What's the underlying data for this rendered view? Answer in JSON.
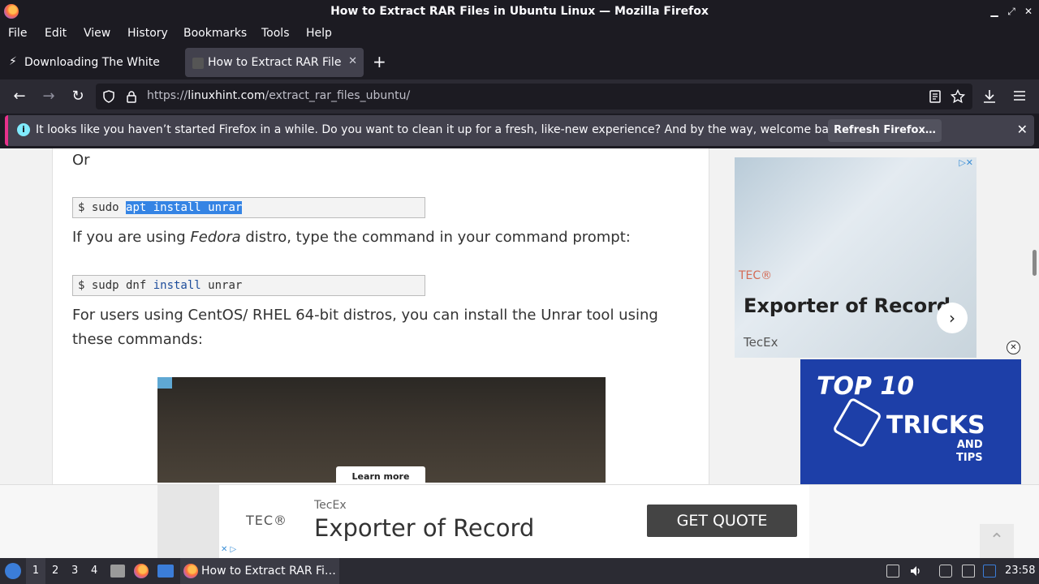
{
  "window": {
    "title": "How to Extract RAR Files in Ubuntu Linux — Mozilla Firefox",
    "minimize": "▁",
    "maximize": "⤢",
    "close": "✕"
  },
  "menu": [
    "File",
    "Edit",
    "View",
    "History",
    "Bookmarks",
    "Tools",
    "Help"
  ],
  "tabs": [
    {
      "label": "Downloading The White H",
      "close": "✕",
      "active": false
    },
    {
      "label": "How to Extract RAR Files",
      "close": "✕",
      "active": true
    }
  ],
  "newtab": "+",
  "nav": {
    "back": "←",
    "forward": "→",
    "reload": "↻",
    "url_prefix": "https://",
    "url_domain": "linuxhint.com",
    "url_path": "/extract_rar_files_ubuntu/"
  },
  "notification": {
    "message": "It looks like you haven’t started Firefox in a while. Do you want to clean it up for a fresh, like-new experience? And by the way, welcome back!",
    "button": "Refresh Firefox…",
    "close": "✕",
    "info": "i"
  },
  "article": {
    "or": "Or",
    "cmd1_prompt": "$ sudo ",
    "cmd1_selected": "apt install unrar",
    "fedora_pre": "If you are using ",
    "fedora_em": "Fedora",
    "fedora_post": " distro, type the command in your command prompt:",
    "cmd2_prompt": "$ sudp dnf ",
    "cmd2_kw": "install",
    "cmd2_rest": " unrar",
    "centos_line1": "For users using CentOS/ RHEL 64-bit distros, you can install the Unrar tool using",
    "centos_line2": "these commands:",
    "ad_learn_more": "Learn more"
  },
  "side_ad_1": {
    "brand": "TEC®",
    "headline": "Exporter of Record",
    "source": "TecEx",
    "arrow": "›",
    "ad_marks": "▷✕"
  },
  "side_ad_2": {
    "top": "TOP 10",
    "tricks": "TRICKS",
    "and": "AND",
    "tips": "TIPS",
    "close": "✕"
  },
  "bottom_ad": {
    "logo": "TEC®",
    "source": "TecEx",
    "headline": "Exporter of Record",
    "cta": "GET QUOTE",
    "ad_marks": "✕ ▷"
  },
  "scroll_top": "⌃",
  "taskbar": {
    "workspaces": [
      "1",
      "2",
      "3",
      "4"
    ],
    "task_label": "How to Extract RAR Fi…",
    "clock": "23:58"
  },
  "colors": {
    "accent": "#e8318b",
    "selection": "#3584e4",
    "ad_blue": "#1d3fa8"
  }
}
